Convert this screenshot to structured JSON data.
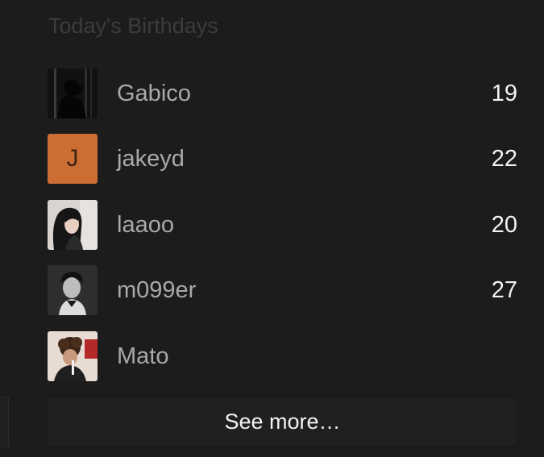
{
  "widget": {
    "title": "Today's Birthdays"
  },
  "birthdays": [
    {
      "name": "Gabico",
      "age": "19",
      "avatar": "photo-silhouette"
    },
    {
      "name": "jakeyd",
      "age": "22",
      "avatar_letter": "J",
      "avatar_color": "#cc6d34"
    },
    {
      "name": "laaoo",
      "age": "20",
      "avatar": "photo-girl"
    },
    {
      "name": "m099er",
      "age": "27",
      "avatar": "photo-man-bw"
    },
    {
      "name": "Mato",
      "age": "",
      "avatar": "photo-curly-hair"
    }
  ],
  "footer": {
    "see_more_label": "See more…"
  }
}
